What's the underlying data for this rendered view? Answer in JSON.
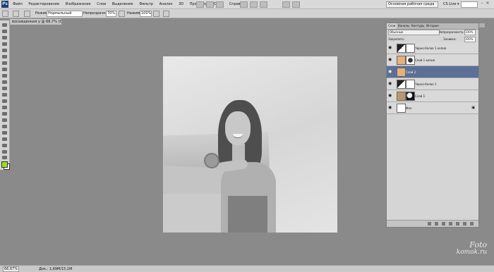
{
  "app": {
    "logo": "Ps"
  },
  "menus": [
    "Файл",
    "Редактирование",
    "Изображение",
    "Слои",
    "Выделение",
    "Фильтр",
    "Анализ",
    "3D",
    "Просмотр",
    "Окно",
    "Справка"
  ],
  "menubar": {
    "workspace": "Основная рабочая среда",
    "live": "CS Live ▾"
  },
  "options": {
    "mode_label": "Режим:",
    "mode_value": "Нормальный",
    "opacity_label": "Непрозрачность:",
    "opacity_value": "70%",
    "flow_label": "Нажим:",
    "flow_value": "100%"
  },
  "document": {
    "tab_title": "восхищенная у @ 66,7% (Слой 2, RGB/8)*"
  },
  "layers_panel": {
    "tabs": [
      "Слои",
      "Каналы",
      "Контуры",
      "История"
    ],
    "blend_mode": "Обычные",
    "opacity_label": "Непрозрачность:",
    "opacity_value": "100%",
    "lock_label": "Закрепить:",
    "fill_label": "Заливка:",
    "fill_value": "100%",
    "layers": [
      {
        "name": "Черно-белое 1 копия",
        "selected": false
      },
      {
        "name": "Слой 1 копия",
        "selected": false
      },
      {
        "name": "Слой 2",
        "selected": true
      },
      {
        "name": "Черно-белое 1",
        "selected": false
      },
      {
        "name": "Слой 1",
        "selected": false
      },
      {
        "name": "Фон",
        "selected": false
      }
    ]
  },
  "status": {
    "zoom": "66,67%",
    "doc": "Док.: 1,69M/15,1M"
  },
  "watermark": {
    "line1": "Foto",
    "line2": "komok.ru"
  },
  "colors": {
    "foreground": "#9be01f",
    "selection": "#5b6f97"
  }
}
